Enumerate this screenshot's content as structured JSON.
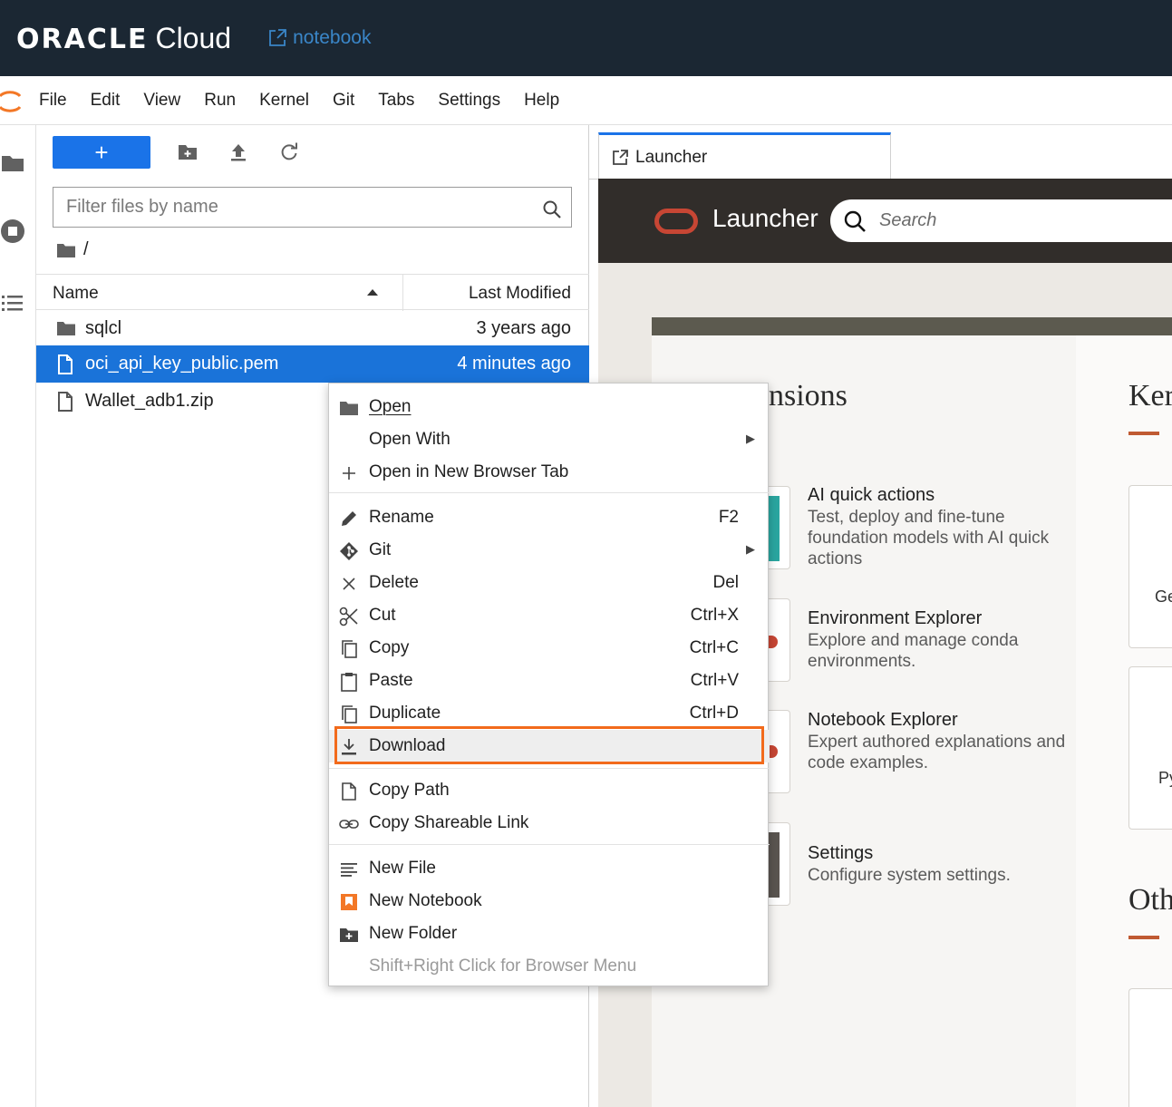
{
  "header": {
    "brand": "ORACLE",
    "brand_suffix": "Cloud",
    "notebook_link": "notebook"
  },
  "menubar": {
    "items": [
      "File",
      "Edit",
      "View",
      "Run",
      "Kernel",
      "Git",
      "Tabs",
      "Settings",
      "Help"
    ]
  },
  "filebrowser": {
    "new_button": "+",
    "filter_placeholder": "Filter files by name",
    "breadcrumb": "/",
    "columns": {
      "name": "Name",
      "modified": "Last Modified"
    },
    "files": [
      {
        "name": "sqlcl",
        "modified": "3 years ago",
        "type": "folder"
      },
      {
        "name": "oci_api_key_public.pem",
        "modified": "4 minutes ago",
        "type": "file"
      },
      {
        "name": "Wallet_adb1.zip",
        "modified": "",
        "type": "file"
      }
    ]
  },
  "launcher": {
    "tab_label": "Launcher",
    "title": "Launcher",
    "search_placeholder": "Search",
    "section_extensions": "nsions",
    "section_kernels": "Ker",
    "section_other": "Oth",
    "extensions": [
      {
        "title": "AI quick actions",
        "desc": "Test, deploy and fine-tune foundation models with AI quick actions"
      },
      {
        "title": "Environment Explorer",
        "desc": "Explore and manage conda environments."
      },
      {
        "title": "Notebook Explorer",
        "desc": "Expert authored explanations and code examples."
      },
      {
        "title": "Settings",
        "desc": "Configure system settings."
      }
    ],
    "kernel_cards": [
      "Ge",
      "Py"
    ]
  },
  "context_menu": {
    "open": "Open",
    "open_with": "Open With",
    "open_new_tab": "Open in New Browser Tab",
    "rename": "Rename",
    "rename_key": "F2",
    "git": "Git",
    "delete": "Delete",
    "delete_key": "Del",
    "cut": "Cut",
    "cut_key": "Ctrl+X",
    "copy": "Copy",
    "copy_key": "Ctrl+C",
    "paste": "Paste",
    "paste_key": "Ctrl+V",
    "duplicate": "Duplicate",
    "duplicate_key": "Ctrl+D",
    "download": "Download",
    "copy_path": "Copy Path",
    "copy_link": "Copy Shareable Link",
    "new_file": "New File",
    "new_notebook": "New Notebook",
    "new_folder": "New Folder",
    "browser_menu_hint": "Shift+Right Click for Browser Menu"
  },
  "colors": {
    "accent": "#1a73e8",
    "highlight": "#f26a1b",
    "oracle_red": "#c74634",
    "topbar": "#1b2733"
  }
}
